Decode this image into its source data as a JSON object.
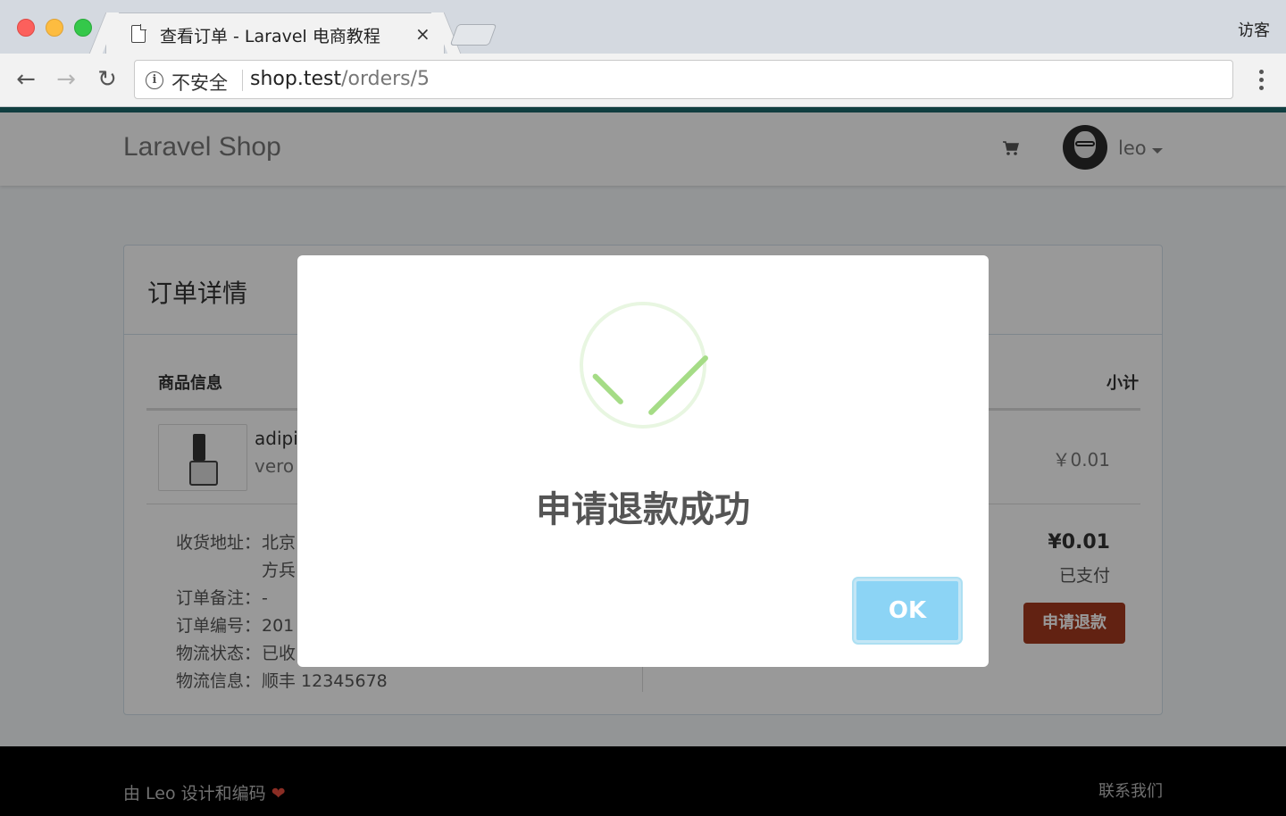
{
  "browser": {
    "tab_title": "查看订单 - Laravel 电商教程",
    "tab_close": "×",
    "guest_label": "访客",
    "insecure_label": "不安全",
    "url_host": "shop.test",
    "url_path": "/orders/5"
  },
  "navbar": {
    "brand": "Laravel Shop",
    "user_name": "leo"
  },
  "order": {
    "panel_title": "订单详情",
    "headers": {
      "product": "商品信息",
      "subtotal": "小计"
    },
    "item": {
      "title": "adipi",
      "sku": "vero",
      "price": "￥0.01"
    },
    "info": [
      {
        "label": "收货地址：",
        "value": "北京"
      },
      {
        "label": "",
        "value": "方兵"
      },
      {
        "label": "订单备注：",
        "value": "-"
      },
      {
        "label": "订单编号：",
        "value": "201"
      },
      {
        "label": "物流状态：",
        "value": "已收"
      },
      {
        "label": "物流信息：",
        "value": "顺丰 12345678"
      }
    ],
    "total": "¥0.01",
    "pay_status": "已支付",
    "refund_button": "申请退款"
  },
  "footer": {
    "left": "由 Leo 设计和编码",
    "heart": "❤",
    "right": "联系我们"
  },
  "modal": {
    "title": "申请退款成功",
    "ok_label": "OK",
    "success_color": "#a5dc86",
    "ok_color": "#8cd4f5"
  }
}
